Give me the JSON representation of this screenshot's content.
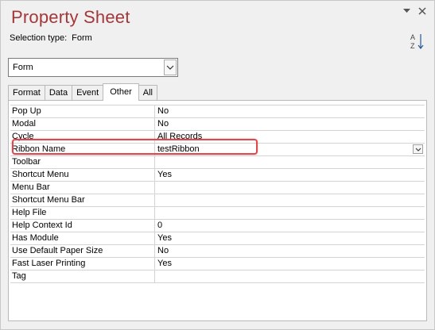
{
  "window": {
    "title": "Property Sheet",
    "selection_type_label": "Selection type:",
    "selection_type_value": "Form"
  },
  "object_selector": {
    "value": "Form"
  },
  "tabs": [
    {
      "label": "Format",
      "active": false
    },
    {
      "label": "Data",
      "active": false
    },
    {
      "label": "Event",
      "active": false
    },
    {
      "label": "Other",
      "active": true
    },
    {
      "label": "All",
      "active": false
    }
  ],
  "properties": [
    {
      "name": "Pop Up",
      "value": "No"
    },
    {
      "name": "Modal",
      "value": "No"
    },
    {
      "name": "Cycle",
      "value": "All Records"
    },
    {
      "name": "Ribbon Name",
      "value": "testRibbon"
    },
    {
      "name": "Toolbar",
      "value": ""
    },
    {
      "name": "Shortcut Menu",
      "value": "Yes"
    },
    {
      "name": "Menu Bar",
      "value": ""
    },
    {
      "name": "Shortcut Menu Bar",
      "value": ""
    },
    {
      "name": "Help File",
      "value": ""
    },
    {
      "name": "Help Context Id",
      "value": "0"
    },
    {
      "name": "Has Module",
      "value": "Yes"
    },
    {
      "name": "Use Default Paper Size",
      "value": "No"
    },
    {
      "name": "Fast Laser Printing",
      "value": "Yes"
    },
    {
      "name": "Tag",
      "value": ""
    }
  ],
  "colors": {
    "title": "#a4373a",
    "highlight": "#e0474c"
  }
}
